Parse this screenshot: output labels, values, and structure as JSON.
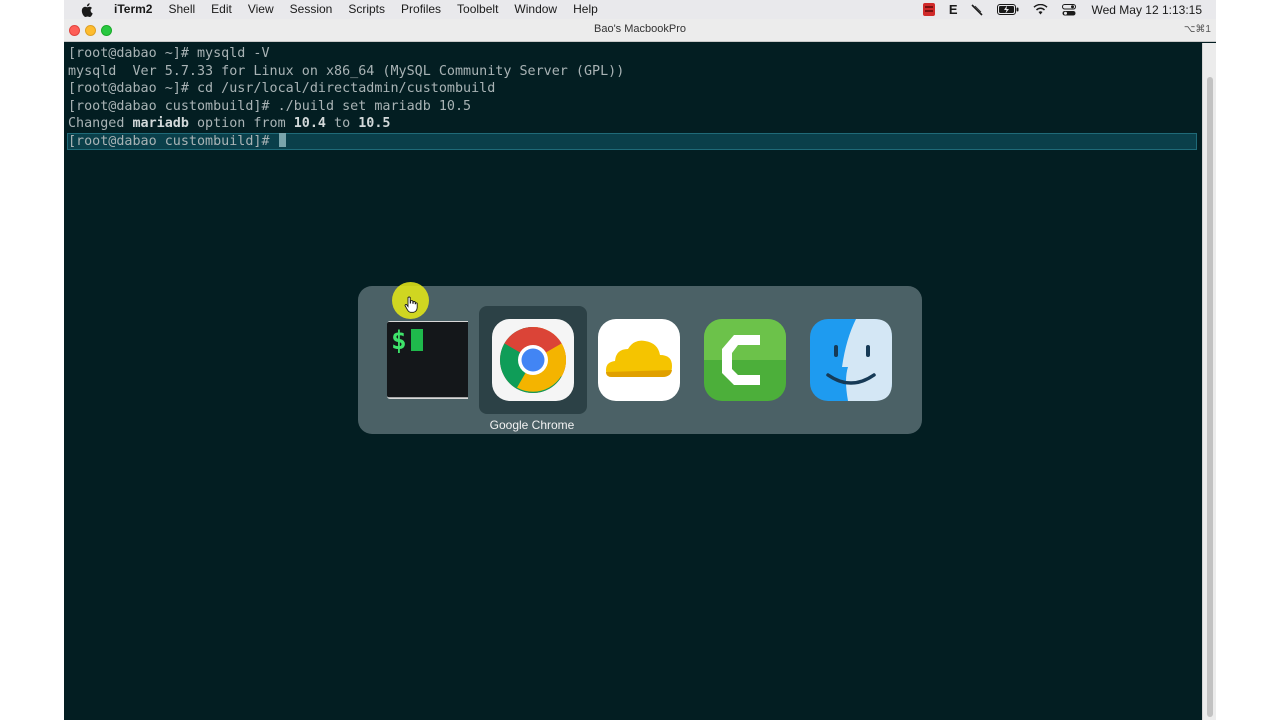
{
  "menubar": {
    "app_name": "iTerm2",
    "items": [
      "Shell",
      "Edit",
      "View",
      "Session",
      "Scripts",
      "Profiles",
      "Toolbelt",
      "Window",
      "Help"
    ],
    "status_letter": "E",
    "clock": "Wed May 12  1:13:15"
  },
  "window": {
    "title": "Bao's MacbookPro",
    "shortcut": "⌥⌘1"
  },
  "terminal": {
    "lines": [
      "[root@dabao ~]# mysqld -V",
      "mysqld  Ver 5.7.33 for Linux on x86_64 (MySQL Community Server (GPL))",
      "[root@dabao ~]# cd /usr/local/directadmin/custombuild",
      "[root@dabao custombuild]# ./build set mariadb 10.5"
    ],
    "changed_line": {
      "prefix": "Changed ",
      "package": "mariadb",
      "middle": " option from ",
      "old_version": "10.4",
      "to": " to ",
      "new_version": "10.5"
    },
    "prompt": "[root@dabao custombuild]# "
  },
  "switcher": {
    "apps": [
      "iterm2-icon",
      "google-chrome-icon",
      "cloud-app-icon",
      "camtasia-icon",
      "finder-icon"
    ],
    "selected_label": "Google Chrome"
  },
  "colors": {
    "terminal_bg": "#031e22",
    "terminal_fg": "#a9b3b5",
    "current_line": "#0a3f4a"
  }
}
